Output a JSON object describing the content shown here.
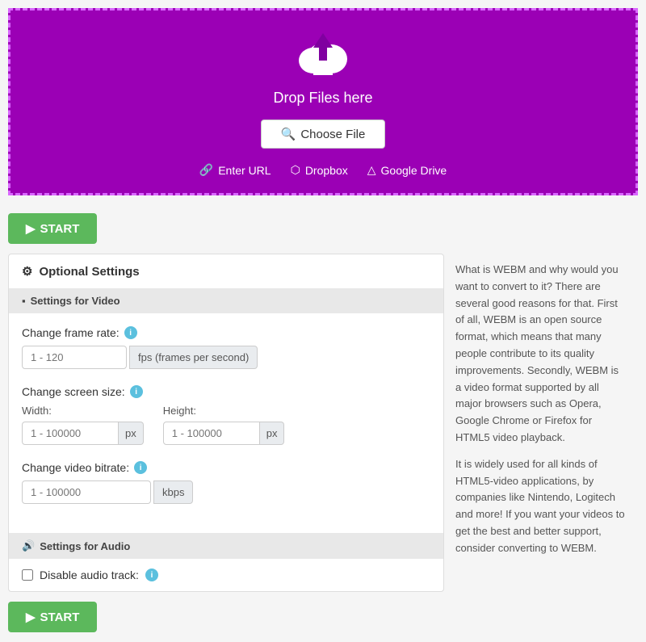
{
  "dropzone": {
    "background_color": "#9b00b5",
    "drop_text": "Drop Files here",
    "choose_file_label": "Choose File",
    "alt_options": [
      {
        "id": "enter-url",
        "label": "Enter URL",
        "icon": "🔗"
      },
      {
        "id": "dropbox",
        "label": "Dropbox",
        "icon": "📦"
      },
      {
        "id": "google-drive",
        "label": "Google Drive",
        "icon": "☁"
      }
    ]
  },
  "start_button": {
    "label": "START",
    "color": "#5cb85c"
  },
  "settings": {
    "title": "Optional Settings",
    "video_section_header": "Settings for Video",
    "audio_section_header": "Settings for Audio",
    "frame_rate": {
      "label": "Change frame rate:",
      "placeholder": "1 - 120",
      "unit": "fps (frames per second)"
    },
    "screen_size": {
      "label": "Change screen size:",
      "width_label": "Width:",
      "width_placeholder": "1 - 100000",
      "height_label": "Height:",
      "height_placeholder": "1 - 100000",
      "unit": "px"
    },
    "video_bitrate": {
      "label": "Change video bitrate:",
      "placeholder": "1 - 100000",
      "unit": "kbps"
    },
    "disable_audio": {
      "label": "Disable audio track:"
    }
  },
  "sidebar": {
    "paragraphs": [
      "What is WEBM and why would you want to convert to it? There are several good reasons for that. First of all, WEBM is an open source format, which means that many people contribute to its quality improvements. Secondly, WEBM is a video format supported by all major browsers such as Opera, Google Chrome or Firefox for HTML5 video playback.",
      "It is widely used for all kinds of HTML5-video applications, by companies like Nintendo, Logitech and more! If you want your videos to get the best and better support, consider converting to WEBM."
    ]
  }
}
